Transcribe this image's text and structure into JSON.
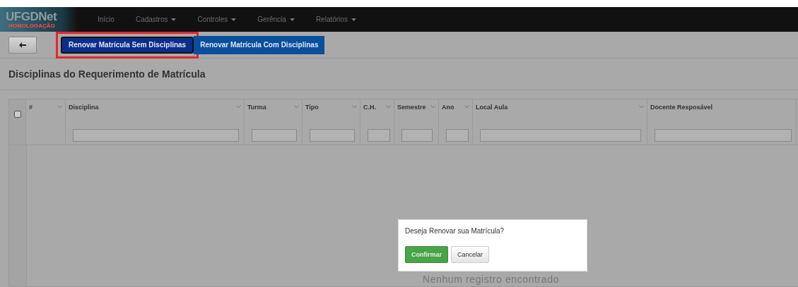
{
  "navbar": {
    "logo": "UFGDNet",
    "environment": "HOMOLOGAÇÃO",
    "items": [
      {
        "label": "Início",
        "dropdown": false
      },
      {
        "label": "Cadastros",
        "dropdown": true
      },
      {
        "label": "Controles",
        "dropdown": true
      },
      {
        "label": "Gerência",
        "dropdown": true
      },
      {
        "label": "Relatórios",
        "dropdown": true
      }
    ]
  },
  "toolbar": {
    "buttons": [
      {
        "label": "Renovar Matrícula Sem Disciplinas",
        "highlighted": true
      },
      {
        "label": "Renovar Matrícula Com Disciplinas",
        "highlighted": false
      }
    ]
  },
  "panel_title": "Disciplinas do Requerimento de Matrícula",
  "table": {
    "select_all": {
      "checked": false
    },
    "columns": [
      {
        "label": "#",
        "menu": true
      },
      {
        "label": "Disciplina",
        "menu": true
      },
      {
        "label": "Turma",
        "menu": true
      },
      {
        "label": "Tipo",
        "menu": true
      },
      {
        "label": "C.H.",
        "menu": true
      },
      {
        "label": "Semestre",
        "menu": true
      },
      {
        "label": "Ano",
        "menu": true
      },
      {
        "label": "Local Aula",
        "menu": true
      },
      {
        "label": "Docente Resposável",
        "menu": false
      }
    ],
    "empty_message": "Nenhum registro encontrado"
  },
  "dialog": {
    "message": "Deseja Renovar sua Matrícula?",
    "buttons": [
      {
        "label": "Confirmar",
        "kind": "primary"
      },
      {
        "label": "Cancelar",
        "kind": "default"
      }
    ]
  }
}
